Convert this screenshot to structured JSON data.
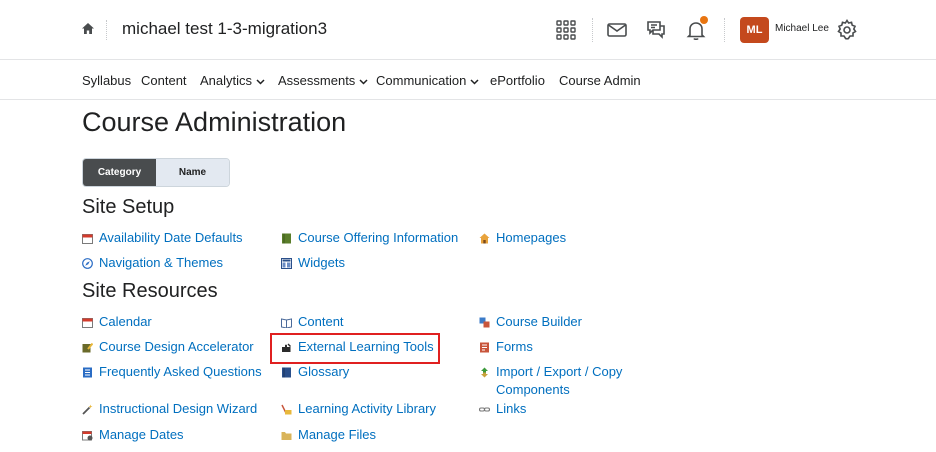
{
  "header": {
    "course_title": "michael test 1-3-migration3",
    "user_initials": "ML",
    "user_name": "Michael Lee",
    "icons": [
      "home-icon",
      "waffle-grid-icon",
      "mail-icon",
      "chat-icon",
      "bell-icon",
      "gear-icon"
    ],
    "accent_color": "#c4491d",
    "notification_dot_color": "#e87511"
  },
  "nav": {
    "items": [
      "Syllabus",
      "Content",
      "Analytics",
      "Assessments",
      "Communication",
      "ePortfolio",
      "Course Admin"
    ]
  },
  "page": {
    "title": "Course Administration",
    "view_toggle": {
      "category": "Category",
      "name": "Name",
      "selected": "Category"
    }
  },
  "sections": {
    "site_setup": {
      "title": "Site Setup",
      "tools": [
        "Availability Date Defaults",
        "Course Offering Information",
        "Homepages",
        "Navigation & Themes",
        "Widgets"
      ]
    },
    "site_resources": {
      "title": "Site Resources",
      "tools": [
        "Calendar",
        "Content",
        "Course Builder",
        "Course Design Accelerator",
        "External Learning Tools",
        "Forms",
        "Frequently Asked Questions",
        "Glossary",
        "Import / Export / Copy Components",
        "Instructional Design Wizard",
        "Learning Activity Library",
        "Links",
        "Manage Dates",
        "Manage Files"
      ]
    }
  },
  "link_color": "#006fbf",
  "highlighted_tool": "External Learning Tools"
}
